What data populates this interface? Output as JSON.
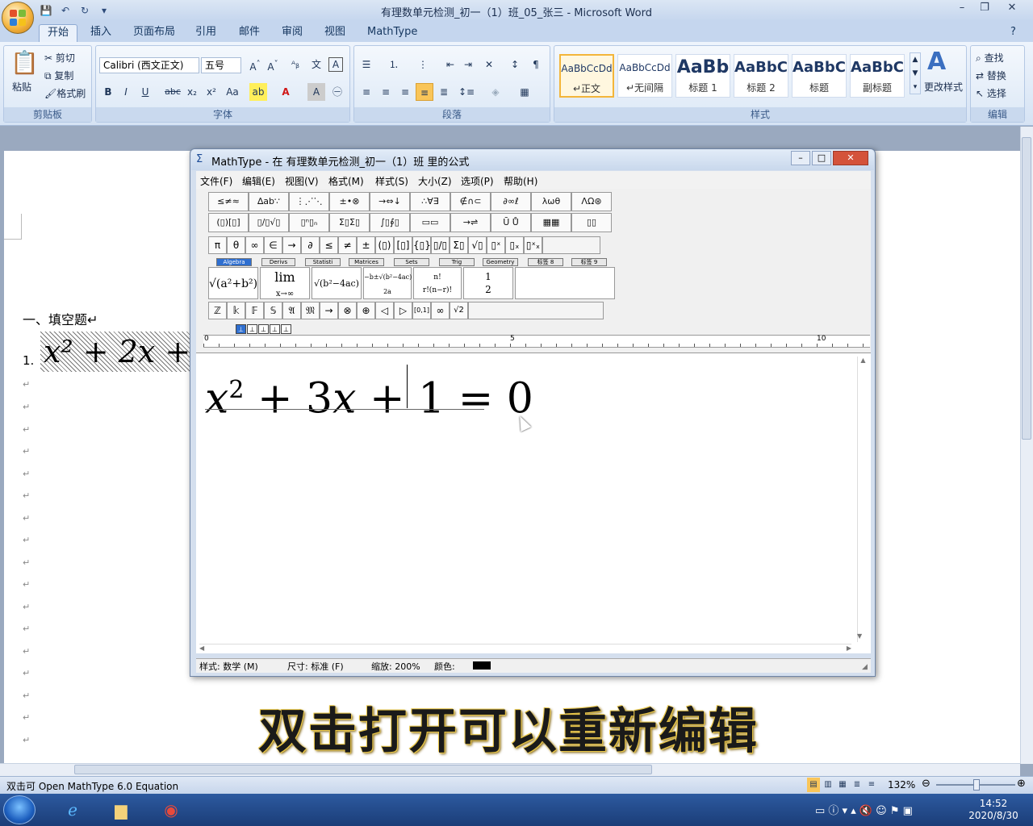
{
  "word": {
    "title": "有理数单元检测_初一（1）班_05_张三 - Microsoft Word",
    "tabs": [
      "开始",
      "插入",
      "页面布局",
      "引用",
      "邮件",
      "审阅",
      "视图",
      "MathType"
    ],
    "active_tab": "开始",
    "clipboard": {
      "paste": "粘贴",
      "cut": "剪切",
      "copy": "复制",
      "format_painter": "格式刷",
      "label": "剪贴板"
    },
    "font": {
      "name": "Calibri (西文正文)",
      "size": "五号",
      "label": "字体"
    },
    "paragraph": {
      "label": "段落"
    },
    "styles": {
      "items": [
        {
          "sample": "AaBbCcDd",
          "name": "↵正文"
        },
        {
          "sample": "AaBbCcDd",
          "name": "↵无间隔"
        },
        {
          "sample": "AaBb",
          "name": "标题 1"
        },
        {
          "sample": "AaBbC",
          "name": "标题 2"
        },
        {
          "sample": "AaBbC",
          "name": "标题"
        },
        {
          "sample": "AaBbC",
          "name": "副标题"
        }
      ],
      "change_styles": "更改样式",
      "label": "样式"
    },
    "editing": {
      "find": "查找",
      "replace": "替换",
      "select": "选择",
      "label": "编辑"
    },
    "document": {
      "heading": "一、填空题↵",
      "q1_number": "1.",
      "q1_equation": "x² + 2x + 1",
      "para_mark": "↵"
    },
    "status_left": "双击可 Open MathType 6.0 Equation",
    "zoom": "132%"
  },
  "mathtype": {
    "title": "MathType - 在 有理数单元检测_初一（1）班 里的公式",
    "menus": [
      "文件(F)",
      "编辑(E)",
      "视图(V)",
      "格式(M)",
      "样式(S)",
      "大小(Z)",
      "选项(P)",
      "帮助(H)"
    ],
    "palette_row1": [
      "≤≠≈",
      "∆ab∵",
      "⋮⋰⋱",
      "±•⊗",
      "→⇔↓",
      "∴∀∃",
      "∉∩⊂",
      "∂∞ℓ",
      "λωθ",
      "ΛΩ⊛"
    ],
    "palette_row2": [
      "(▯)[▯]",
      "▯/▯√▯",
      "▯ⁿ▯ₙ",
      "Σ▯Σ▯",
      "∫▯∮▯",
      "▭▭",
      "→⇌",
      "Ū Ů",
      "▦▦",
      "▯▯"
    ],
    "palette_row3": [
      "π",
      "θ",
      "∞",
      "∈",
      "→",
      "∂",
      "≤",
      "≠",
      "±",
      "(▯)",
      "[▯]",
      "{▯}",
      "▯/▯",
      "Σ▯",
      "√▯",
      "▯ˣ",
      "▯ₓ",
      "▯ˣₓ"
    ],
    "palette_tabs": [
      "Algebra",
      "Derivs",
      "Statisti",
      "Matrices",
      "Sets",
      "Trig",
      "Geometry",
      "标签 8",
      "标签 9"
    ],
    "palette_row5": [
      "ℤ",
      "𝕜",
      "𝔽",
      "𝕊",
      "𝔄",
      "𝔐",
      "→",
      "⊗",
      "⊕",
      "◁",
      "▷",
      "[0,1]",
      "∞",
      "√2"
    ],
    "equation": {
      "x": "x",
      "exp": "2",
      "rest": " + 3",
      "x2": "x",
      "tail": " + 1 = 0"
    },
    "ruler_marks": [
      "0",
      "5",
      "10"
    ],
    "status": {
      "style": "样式: 数学 (M)",
      "size": "尺寸: 标准 (F)",
      "zoom": "缩放: 200%",
      "color": "颜色:"
    }
  },
  "caption": "双击打开可以重新编辑",
  "taskbar": {
    "time": "14:52",
    "date": "2020/8/30"
  }
}
